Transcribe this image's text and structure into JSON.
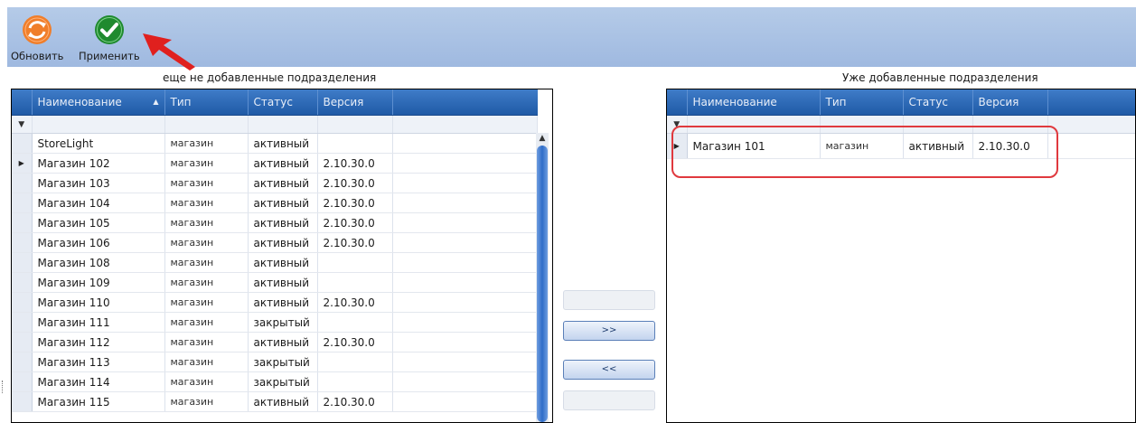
{
  "toolbar": {
    "refresh_label": "Обновить",
    "apply_label": "Применить",
    "refresh_color": "#f07e2a",
    "apply_color": "#1f8a2e",
    "annotation_color": "#e0201e"
  },
  "left_panel": {
    "caption": "еще не добавленные подразделения",
    "columns": [
      "Наименование",
      "Тип",
      "Статус",
      "Версия"
    ],
    "sorted_column": "Наименование",
    "current_row": "Магазин 102",
    "rows": [
      {
        "name": "StoreLight",
        "type": "магазин",
        "status": "активный",
        "version": ""
      },
      {
        "name": "Магазин 102",
        "type": "магазин",
        "status": "активный",
        "version": "2.10.30.0"
      },
      {
        "name": "Магазин 103",
        "type": "магазин",
        "status": "активный",
        "version": "2.10.30.0"
      },
      {
        "name": "Магазин 104",
        "type": "магазин",
        "status": "активный",
        "version": "2.10.30.0"
      },
      {
        "name": "Магазин 105",
        "type": "магазин",
        "status": "активный",
        "version": "2.10.30.0"
      },
      {
        "name": "Магазин 106",
        "type": "магазин",
        "status": "активный",
        "version": "2.10.30.0"
      },
      {
        "name": "Магазин 108",
        "type": "магазин",
        "status": "активный",
        "version": ""
      },
      {
        "name": "Магазин 109",
        "type": "магазин",
        "status": "активный",
        "version": ""
      },
      {
        "name": "Магазин 110",
        "type": "магазин",
        "status": "активный",
        "version": "2.10.30.0"
      },
      {
        "name": "Магазин 111",
        "type": "магазин",
        "status": "закрытый",
        "version": ""
      },
      {
        "name": "Магазин 112",
        "type": "магазин",
        "status": "активный",
        "version": "2.10.30.0"
      },
      {
        "name": "Магазин 113",
        "type": "магазин",
        "status": "закрытый",
        "version": ""
      },
      {
        "name": "Магазин 114",
        "type": "магазин",
        "status": "закрытый",
        "version": ""
      },
      {
        "name": "Магазин 115",
        "type": "магазин",
        "status": "активный",
        "version": "2.10.30.0"
      }
    ]
  },
  "middle": {
    "add_label": ">>",
    "remove_label": "<<",
    "add_all_label": "",
    "remove_all_label": ""
  },
  "right_panel": {
    "caption": "Уже добавленные подразделения",
    "columns": [
      "Наименование",
      "Тип",
      "Статус",
      "Версия"
    ],
    "current_row": "Магазин 101",
    "rows": [
      {
        "name": "Магазин 101",
        "type": "магазин",
        "status": "активный",
        "version": "2.10.30.0"
      }
    ],
    "highlight_color": "#e0393e"
  }
}
